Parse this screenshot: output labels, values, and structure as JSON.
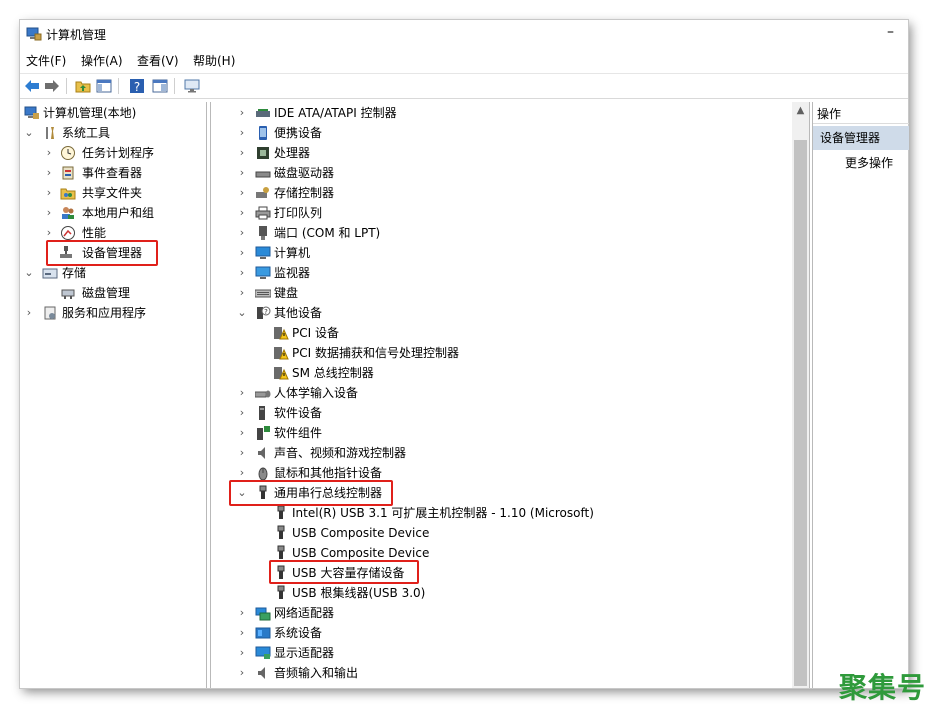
{
  "window": {
    "title": "计算机管理",
    "minimize_glyph": "–"
  },
  "menu": [
    {
      "label": "文件(F)"
    },
    {
      "label": "操作(A)"
    },
    {
      "label": "查看(V)"
    },
    {
      "label": "帮助(H)"
    }
  ],
  "toolbar": {
    "buttons": [
      "back-arrow-icon",
      "forward-arrow-icon",
      "up-folder-icon",
      "show-hide-tree-icon",
      "help-icon",
      "properties-icon",
      "monitor-icon"
    ]
  },
  "left_tree": {
    "root": "计算机管理(本地)",
    "system_tools": "系统工具",
    "task_scheduler": "任务计划程序",
    "event_viewer": "事件查看器",
    "shared_folders": "共享文件夹",
    "local_users": "本地用户和组",
    "performance": "性能",
    "device_manager": "设备管理器",
    "storage": "存储",
    "disk_management": "磁盘管理",
    "services_apps": "服务和应用程序"
  },
  "device_tree": {
    "ide": "IDE ATA/ATAPI 控制器",
    "portable": "便携设备",
    "processor": "处理器",
    "disk_drives": "磁盘驱动器",
    "storage_ctrl": "存储控制器",
    "print_queue": "打印队列",
    "ports": "端口 (COM 和 LPT)",
    "computer": "计算机",
    "monitors": "监视器",
    "keyboard": "键盘",
    "other_devices": "其他设备",
    "pci_device": "PCI 设备",
    "pci_data": "PCI 数据捕获和信号处理控制器",
    "sm_bus": "SM 总线控制器",
    "hid": "人体学输入设备",
    "software_devices": "软件设备",
    "software_components": "软件组件",
    "sound": "声音、视频和游戏控制器",
    "mice": "鼠标和其他指针设备",
    "usb_controllers": "通用串行总线控制器",
    "usb_intel": "Intel(R) USB 3.1 可扩展主机控制器 - 1.10 (Microsoft)",
    "usb_composite_1": "USB Composite Device",
    "usb_composite_2": "USB Composite Device",
    "usb_mass_storage": "USB 大容量存储设备",
    "usb_root_hub": "USB 根集线器(USB 3.0)",
    "network": "网络适配器",
    "system_devices": "系统设备",
    "display": "显示适配器",
    "audio_io": "音频输入和输出"
  },
  "actions": {
    "header": "操作",
    "section": "设备管理器",
    "more": "更多操作"
  },
  "watermark": "聚集号",
  "colors": {
    "highlight": "#e0201a",
    "action_section_bg": "#cfdbe9",
    "watermark": "#2f9a3b"
  }
}
